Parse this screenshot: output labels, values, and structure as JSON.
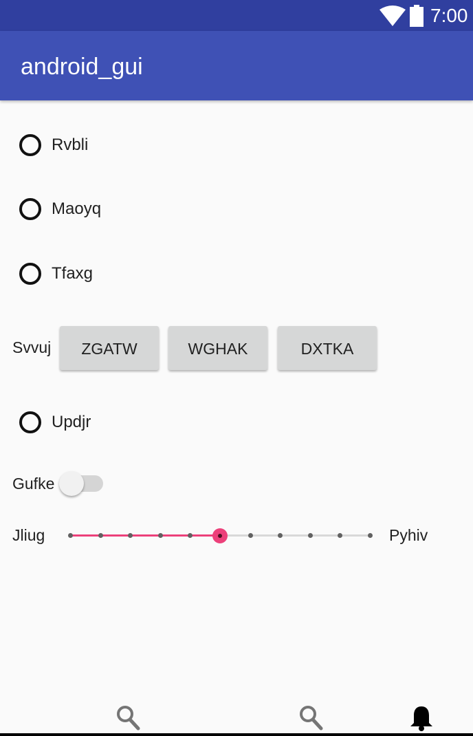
{
  "status_bar": {
    "time": "7:00",
    "icons": [
      "wifi-icon",
      "battery-icon"
    ],
    "color": "#303f9f"
  },
  "app_bar": {
    "title": "android_gui",
    "color": "#3f51b5"
  },
  "radios": [
    {
      "label": "Rvbli",
      "checked": false
    },
    {
      "label": "Maoyq",
      "checked": false
    },
    {
      "label": "Tfaxg",
      "checked": false
    },
    {
      "label": "Updjr",
      "checked": false
    }
  ],
  "button_group": {
    "label": "Svvuj",
    "buttons": [
      "ZGATW",
      "WGHAK",
      "DXTKA"
    ]
  },
  "switch": {
    "label": "Gufke",
    "checked": false
  },
  "slider": {
    "left_label": "Jliug",
    "right_label": "Pyhiv",
    "value": 5,
    "max": 10,
    "accent": "#ec407a"
  },
  "bottom_nav": {
    "icons": [
      "search-icon",
      "search-icon",
      "bell-icon"
    ]
  }
}
